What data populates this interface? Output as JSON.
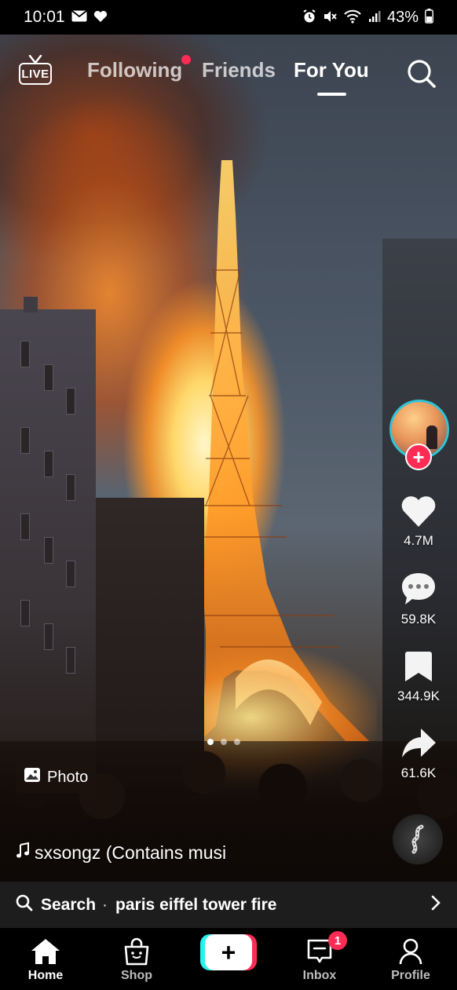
{
  "status_bar": {
    "time": "10:01",
    "battery": "43%",
    "left_icons": [
      "mail-icon",
      "heart-icon"
    ],
    "right_icons": [
      "alarm-icon",
      "mute-icon",
      "wifi-icon",
      "signal-icon",
      "battery-icon"
    ]
  },
  "top_nav": {
    "live_label": "LIVE",
    "tabs": [
      {
        "label": "Following",
        "has_dot": true
      },
      {
        "label": "Friends"
      },
      {
        "label": "For You",
        "active": true
      }
    ],
    "search_icon": "search-icon"
  },
  "actions": {
    "likes": "4.7M",
    "comments": "59.8K",
    "bookmarks": "344.9K",
    "shares": "61.6K",
    "follow_symbol": "+"
  },
  "post": {
    "photo_label": "Photo",
    "slide_count": 3,
    "active_slide": 1,
    "music_text": "sxsongz (Contains musi"
  },
  "search_bar": {
    "label": "Search",
    "separator": "·",
    "query": "paris eiffel tower fire"
  },
  "bottom_nav": {
    "items": [
      {
        "label": "Home",
        "icon": "home-icon",
        "active": true
      },
      {
        "label": "Shop",
        "icon": "shop-icon"
      },
      {
        "label": "+",
        "icon": "create-icon"
      },
      {
        "label": "Inbox",
        "icon": "inbox-icon",
        "badge": "1"
      },
      {
        "label": "Profile",
        "icon": "profile-icon"
      }
    ]
  },
  "colors": {
    "accent_red": "#fe2c55",
    "accent_cyan": "#25f4ee",
    "avatar_ring": "#2ec4d6"
  }
}
